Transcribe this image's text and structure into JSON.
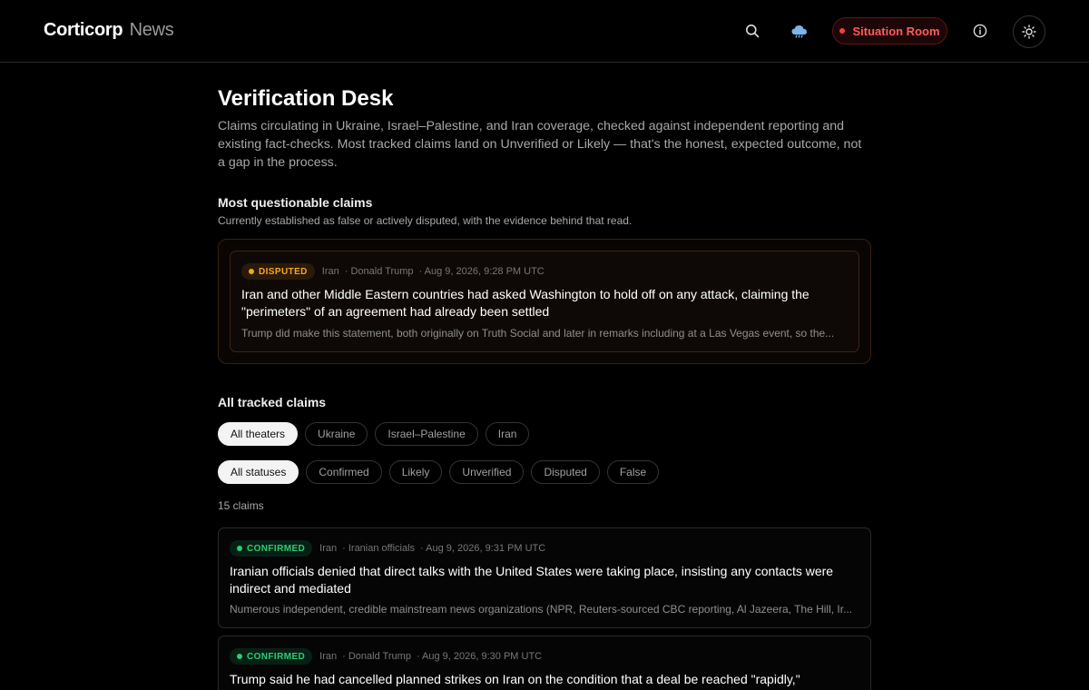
{
  "header": {
    "brand_main": "Corticorp",
    "brand_sub": "News",
    "situation_room_label": "Situation Room",
    "icons": [
      "search-icon",
      "weather-cloud-icon",
      "info-icon",
      "sun-icon"
    ],
    "colors": {
      "alert_red": "#ff5b5b",
      "disputed": "#f5a524",
      "confirmed": "#2ecc71"
    }
  },
  "page": {
    "title": "Verification Desk",
    "description": "Claims circulating in Ukraine, Israel–Palestine, and Iran coverage, checked against independent reporting and existing fact-checks. Most tracked claims land on Unverified or Likely — that's the honest, expected outcome, not a gap in the process."
  },
  "questionable": {
    "title": "Most questionable claims",
    "subtitle": "Currently established as false or actively disputed, with the evidence behind that read.",
    "items": [
      {
        "status": "DISPUTED",
        "theater": "Iran",
        "source": "· Donald Trump",
        "time": "· Aug 9, 2026, 9:28 PM UTC",
        "claim": "Iran and other Middle Eastern countries had asked Washington to hold off on any attack, claiming the \"perimeters\" of an agreement had already been settled",
        "snippet": "Trump did make this statement, both originally on Truth Social and later in remarks including at a Las Vegas event, so the..."
      }
    ]
  },
  "tracked": {
    "title": "All tracked claims",
    "theater_filters": [
      "All theaters",
      "Ukraine",
      "Israel–Palestine",
      "Iran"
    ],
    "status_filters": [
      "All statuses",
      "Confirmed",
      "Likely",
      "Unverified",
      "Disputed",
      "False"
    ],
    "active_theater": "All theaters",
    "active_status": "All statuses",
    "count_label": "15 claims",
    "items": [
      {
        "status": "CONFIRMED",
        "theater": "Iran",
        "source": "· Iranian officials",
        "time": "· Aug 9, 2026, 9:31 PM UTC",
        "claim": "Iranian officials denied that direct talks with the United States were taking place, insisting any contacts were indirect and mediated",
        "snippet": "Numerous independent, credible mainstream news organizations (NPR, Reuters-sourced CBC reporting, Al Jazeera, The Hill, Ir..."
      },
      {
        "status": "CONFIRMED",
        "theater": "Iran",
        "source": "· Donald Trump",
        "time": "· Aug 9, 2026, 9:30 PM UTC",
        "claim": "Trump said he had cancelled planned strikes on Iran on the condition that a deal be reached \"rapidly,\" claiming"
      }
    ]
  }
}
